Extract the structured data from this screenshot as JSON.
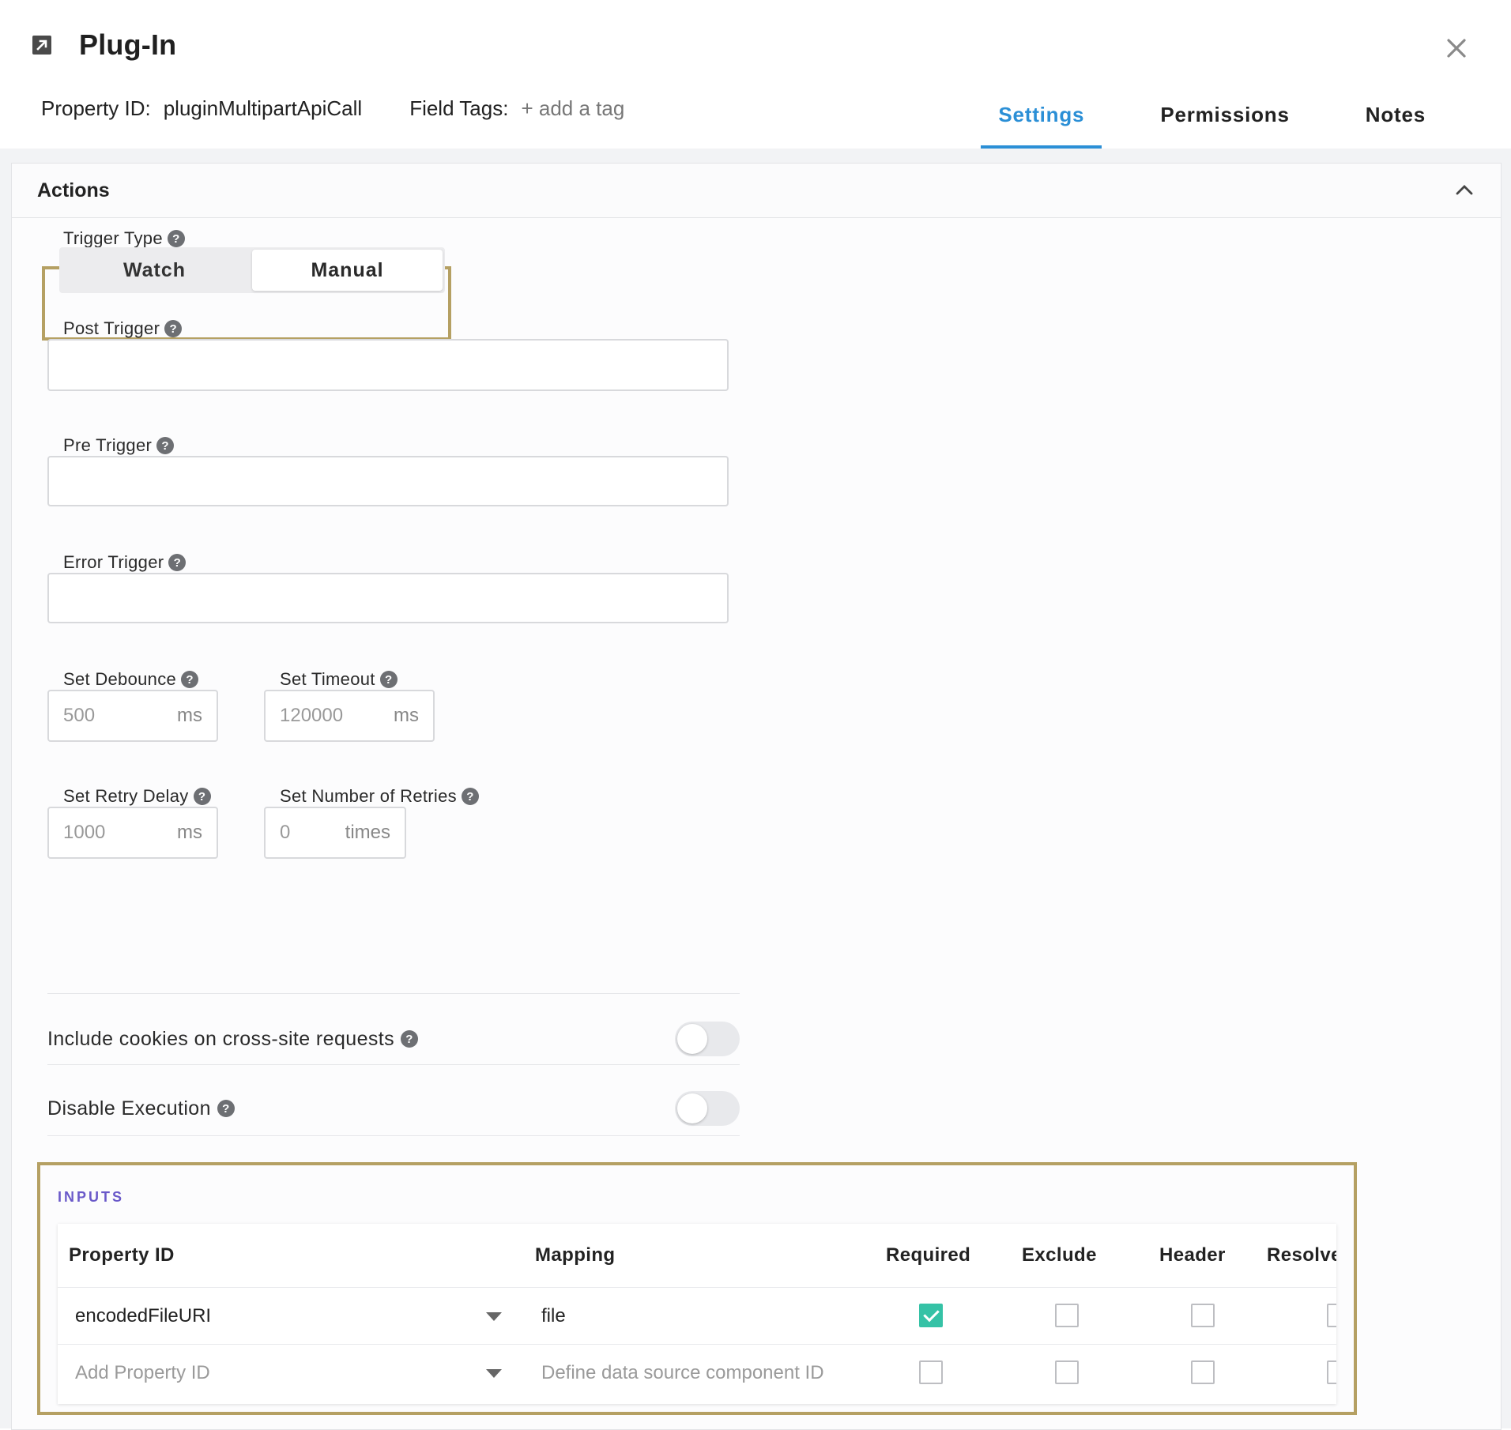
{
  "header": {
    "title": "Plug-In",
    "property_id_label": "Property ID:",
    "property_id_value": "pluginMultipartApiCall",
    "field_tags_label": "Field Tags:",
    "add_tag": "+ add a tag",
    "tabs": [
      {
        "label": "Settings",
        "active": true
      },
      {
        "label": "Permissions",
        "active": false
      },
      {
        "label": "Notes",
        "active": false
      }
    ]
  },
  "actions": {
    "title": "Actions",
    "trigger_type": {
      "label": "Trigger Type",
      "options": [
        "Watch",
        "Manual"
      ],
      "selected": "Manual"
    },
    "post_trigger": {
      "label": "Post Trigger",
      "value": ""
    },
    "pre_trigger": {
      "label": "Pre Trigger",
      "value": ""
    },
    "error_trigger": {
      "label": "Error Trigger",
      "value": ""
    },
    "debounce": {
      "label": "Set Debounce",
      "placeholder": "500",
      "unit": "ms"
    },
    "timeout": {
      "label": "Set Timeout",
      "placeholder": "120000",
      "unit": "ms"
    },
    "retry_delay": {
      "label": "Set Retry Delay",
      "placeholder": "1000",
      "unit": "ms"
    },
    "retries": {
      "label": "Set Number of Retries",
      "placeholder": "0",
      "unit": "times"
    },
    "include_cookies": {
      "label": "Include cookies on cross-site requests",
      "on": false
    },
    "disable_execution": {
      "label": "Disable Execution",
      "on": false
    }
  },
  "inputs": {
    "title": "INPUTS",
    "columns": [
      "Property ID",
      "Mapping",
      "Required",
      "Exclude",
      "Header",
      "Resolve"
    ],
    "rows": [
      {
        "property_id": "encodedFileURI",
        "mapping": "file",
        "required": true,
        "exclude": false,
        "header": false,
        "resolve": false
      },
      {
        "property_id_placeholder": "Add Property ID",
        "mapping_placeholder": "Define data source component ID",
        "required": false,
        "exclude": false,
        "header": false,
        "resolve": false
      }
    ]
  },
  "colors": {
    "accent": "#2b8fd6",
    "highlight": "#b5a063",
    "checkbox_checked": "#35c2a6",
    "inputs_title": "#6a59c9"
  },
  "icons": {
    "title": "external-link-square-icon",
    "close": "close-icon",
    "collapse": "chevron-up-icon",
    "help": "question-circle-icon",
    "dropdown": "caret-down-icon",
    "check": "check-icon"
  }
}
